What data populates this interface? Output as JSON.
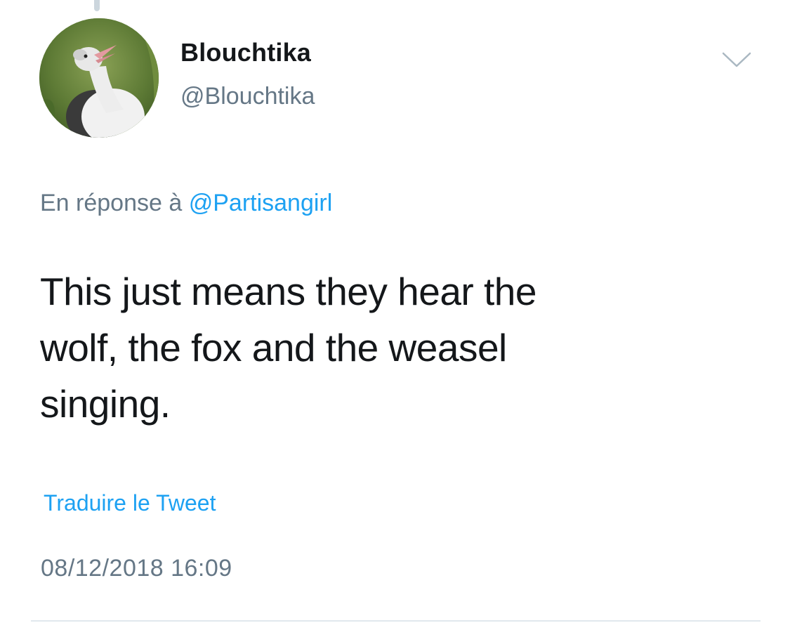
{
  "author": {
    "display_name": "Blouchtika",
    "handle": "@Blouchtika",
    "avatar_icon": "goose-avatar-icon"
  },
  "reply": {
    "prefix": "En réponse à",
    "to_handle": "@Partisangirl"
  },
  "tweet": {
    "text_lines": [
      "This just means they hear the",
      "wolf, the fox and the weasel",
      "singing."
    ]
  },
  "translate_label": "Traduire le Tweet",
  "timestamp": "08/12/2018 16:09",
  "colors": {
    "link": "#1da1f2",
    "secondary_text": "#657786",
    "primary_text": "#14171a"
  }
}
